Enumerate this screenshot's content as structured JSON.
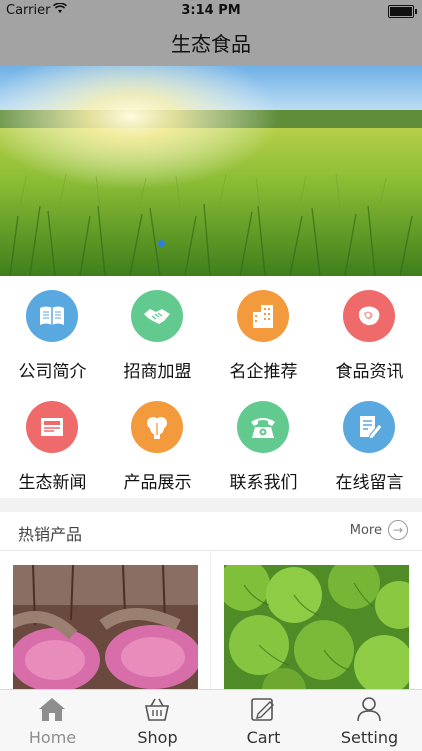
{
  "status_bar": {
    "carrier": "Carrier",
    "time": "3:14 PM"
  },
  "header": {
    "title": "生态食品"
  },
  "grid": {
    "items": [
      {
        "label": "公司简介",
        "icon": "book-icon",
        "color": "#59a8e0"
      },
      {
        "label": "招商加盟",
        "icon": "handshake-icon",
        "color": "#62c98f"
      },
      {
        "label": "名企推荐",
        "icon": "building-icon",
        "color": "#f39a3c"
      },
      {
        "label": "食品资讯",
        "icon": "meat-icon",
        "color": "#ef6a6a"
      },
      {
        "label": "生态新闻",
        "icon": "newspaper-icon",
        "color": "#ef6a6a"
      },
      {
        "label": "产品展示",
        "icon": "vegetable-icon",
        "color": "#f39a3c"
      },
      {
        "label": "联系我们",
        "icon": "telephone-icon",
        "color": "#62c98f"
      },
      {
        "label": "在线留言",
        "icon": "message-icon",
        "color": "#59a8e0"
      }
    ]
  },
  "hot_products": {
    "title": "热销产品",
    "more_label": "More"
  },
  "tabbar": {
    "items": [
      {
        "label": "Home",
        "icon": "home-icon"
      },
      {
        "label": "Shop",
        "icon": "basket-icon"
      },
      {
        "label": "Cart",
        "icon": "edit-icon"
      },
      {
        "label": "Setting",
        "icon": "person-icon"
      }
    ]
  }
}
